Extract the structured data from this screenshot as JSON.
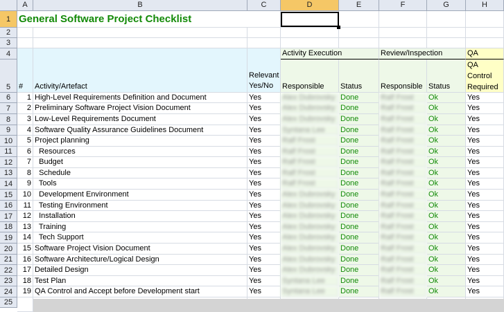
{
  "columns": [
    "A",
    "B",
    "C",
    "D",
    "E",
    "F",
    "G",
    "H"
  ],
  "selected_cell": "D1",
  "title": "General Software Project Checklist",
  "header": {
    "group_activity_execution": "Activity Execution",
    "group_review_inspection": "Review/Inspection",
    "group_qa": "QA",
    "col_num": "#",
    "col_activity": "Activity/Artefact",
    "col_relevant": "Relevant Yes/No",
    "col_responsible": "Responsible",
    "col_status": "Status",
    "col_review_responsible": "Responsible",
    "col_review_status": "Status",
    "col_qa": "QA Control Required"
  },
  "rows": [
    {
      "n": "1",
      "activity": "High-Level Requirements Definition and Document",
      "relevant": "Yes",
      "resp": "Alex Dubrovsky",
      "status": "Done",
      "rresp": "Ralf Frost",
      "rstatus": "Ok",
      "qa": "Yes"
    },
    {
      "n": "2",
      "activity": "Preliminary Software Project Vision Document",
      "relevant": "Yes",
      "resp": "Alex Dubrovsky",
      "status": "Done",
      "rresp": "Ralf Frost",
      "rstatus": "Ok",
      "qa": "Yes"
    },
    {
      "n": "3",
      "activity": "Low-Level Requirements Document",
      "relevant": "Yes",
      "resp": "Alex Dubrovsky",
      "status": "Done",
      "rresp": "Ralf Frost",
      "rstatus": "Ok",
      "qa": "Yes"
    },
    {
      "n": "4",
      "activity": "Software Quality Assurance Guidelines Document",
      "relevant": "Yes",
      "resp": "Syntana Lee",
      "status": "Done",
      "rresp": "Ralf Frost",
      "rstatus": "Ok",
      "qa": "Yes"
    },
    {
      "n": "5",
      "activity": "Project planning",
      "relevant": "Yes",
      "resp": "Ralf Frost",
      "status": "Done",
      "rresp": "Ralf Frost",
      "rstatus": "Ok",
      "qa": "Yes"
    },
    {
      "n": "6",
      "activity": "  Resources",
      "relevant": "Yes",
      "resp": "Ralf Frost",
      "status": "Done",
      "rresp": "Ralf Frost",
      "rstatus": "Ok",
      "qa": "Yes"
    },
    {
      "n": "7",
      "activity": "  Budget",
      "relevant": "Yes",
      "resp": "Ralf Frost",
      "status": "Done",
      "rresp": "Ralf Frost",
      "rstatus": "Ok",
      "qa": "Yes"
    },
    {
      "n": "8",
      "activity": "  Schedule",
      "relevant": "Yes",
      "resp": "Ralf Frost",
      "status": "Done",
      "rresp": "Ralf Frost",
      "rstatus": "Ok",
      "qa": "Yes"
    },
    {
      "n": "9",
      "activity": "  Tools",
      "relevant": "Yes",
      "resp": "Ralf Frost",
      "status": "Done",
      "rresp": "Ralf Frost",
      "rstatus": "Ok",
      "qa": "Yes"
    },
    {
      "n": "10",
      "activity": "  Development Environment",
      "relevant": "Yes",
      "resp": "Alex Dubrovsky",
      "status": "Done",
      "rresp": "Ralf Frost",
      "rstatus": "Ok",
      "qa": "Yes"
    },
    {
      "n": "11",
      "activity": "  Testing Environment",
      "relevant": "Yes",
      "resp": "Alex Dubrovsky",
      "status": "Done",
      "rresp": "Ralf Frost",
      "rstatus": "Ok",
      "qa": "Yes"
    },
    {
      "n": "12",
      "activity": "  Installation",
      "relevant": "Yes",
      "resp": "Alex Dubrovsky",
      "status": "Done",
      "rresp": "Ralf Frost",
      "rstatus": "Ok",
      "qa": "Yes"
    },
    {
      "n": "13",
      "activity": "  Training",
      "relevant": "Yes",
      "resp": "Alex Dubrovsky",
      "status": "Done",
      "rresp": "Ralf Frost",
      "rstatus": "Ok",
      "qa": "Yes"
    },
    {
      "n": "14",
      "activity": "  Tech Support",
      "relevant": "Yes",
      "resp": "Alex Dubrovsky",
      "status": "Done",
      "rresp": "Ralf Frost",
      "rstatus": "Ok",
      "qa": "Yes"
    },
    {
      "n": "15",
      "activity": "Software Project Vision Document",
      "relevant": "Yes",
      "resp": "Alex Dubrovsky",
      "status": "Done",
      "rresp": "Ralf Frost",
      "rstatus": "Ok",
      "qa": "Yes"
    },
    {
      "n": "16",
      "activity": "Software Architecture/Logical Design",
      "relevant": "Yes",
      "resp": "Alex Dubrovsky",
      "status": "Done",
      "rresp": "Ralf Frost",
      "rstatus": "Ok",
      "qa": "Yes"
    },
    {
      "n": "17",
      "activity": "Detailed Design",
      "relevant": "Yes",
      "resp": "Alex Dubrovsky",
      "status": "Done",
      "rresp": "Ralf Frost",
      "rstatus": "Ok",
      "qa": "Yes"
    },
    {
      "n": "18",
      "activity": "Test Plan",
      "relevant": "Yes",
      "resp": "Syntana Lee",
      "status": "Done",
      "rresp": "Ralf Frost",
      "rstatus": "Ok",
      "qa": "Yes"
    },
    {
      "n": "19",
      "activity": "QA Control and Accept before Development start",
      "relevant": "Yes",
      "resp": "Syntana Lee",
      "status": "Done",
      "rresp": "Ralf Frost",
      "rstatus": "Ok",
      "qa": "Yes"
    }
  ],
  "row_numbers": [
    "1",
    "2",
    "3",
    "4",
    "5",
    "6",
    "7",
    "8",
    "9",
    "10",
    "11",
    "12",
    "13",
    "14",
    "15",
    "16",
    "17",
    "18",
    "19",
    "20",
    "21",
    "22",
    "23",
    "24",
    "25"
  ],
  "colors": {
    "title_green": "#138a08",
    "header_blue": "#e3f6fd",
    "header_green": "#eef8e8",
    "header_yellow": "#ffffc6",
    "selection_orange": "#f5c766"
  }
}
